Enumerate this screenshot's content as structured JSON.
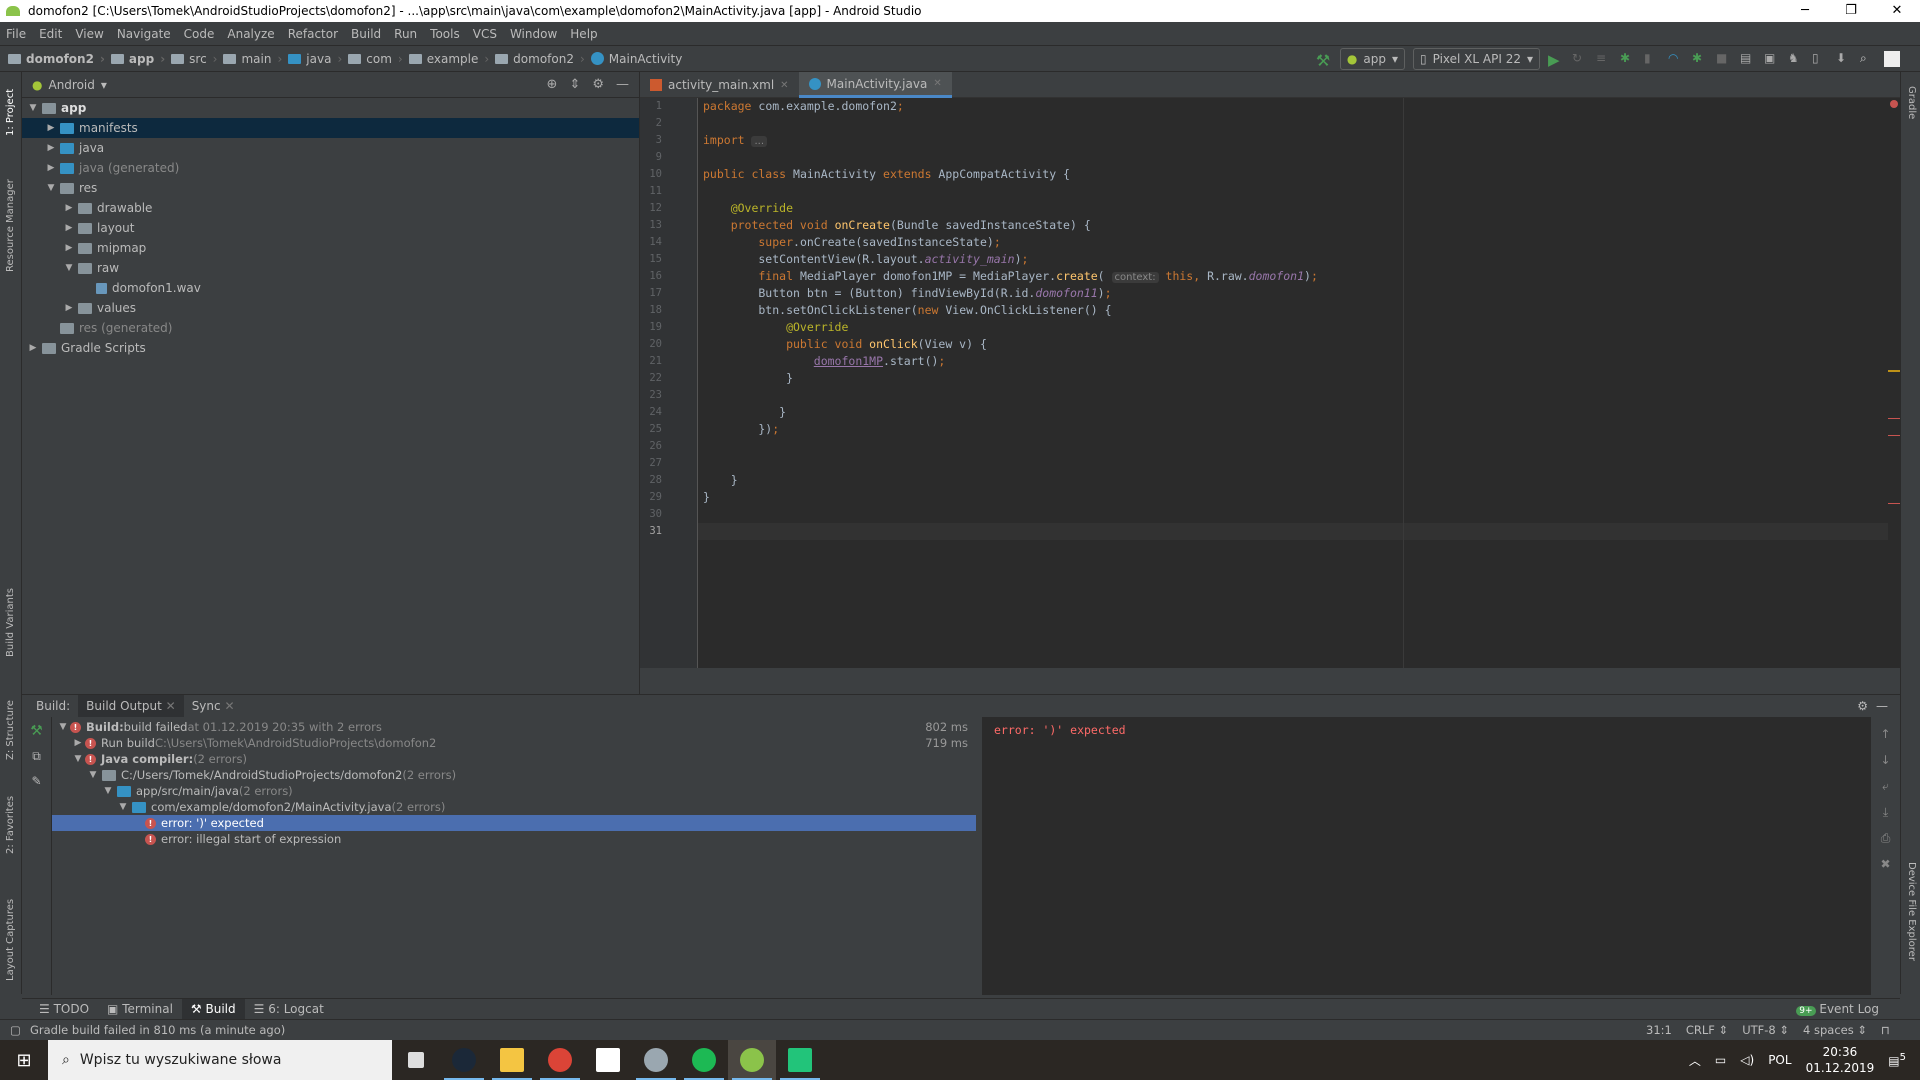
{
  "window": {
    "title": "domofon2 [C:\\Users\\Tomek\\AndroidStudioProjects\\domofon2] - ...\\app\\src\\main\\java\\com\\example\\domofon2\\MainActivity.java [app] - Android Studio",
    "minimize": "─",
    "maximize": "❐",
    "close": "✕"
  },
  "menu": [
    "File",
    "Edit",
    "View",
    "Navigate",
    "Code",
    "Analyze",
    "Refactor",
    "Build",
    "Run",
    "Tools",
    "VCS",
    "Window",
    "Help"
  ],
  "breadcrumbs": [
    "domofon2",
    "app",
    "src",
    "main",
    "java",
    "com",
    "example",
    "domofon2",
    "MainActivity"
  ],
  "toolbar": {
    "config": "app",
    "device": "Pixel XL API 22"
  },
  "left_strip": [
    "1: Project",
    "Resource Manager",
    "Build Variants",
    "Z: Structure",
    "2: Favorites",
    "Layout Captures"
  ],
  "right_strip": [
    "Gradle",
    "Device File Explorer"
  ],
  "project": {
    "view": "Android",
    "tree": [
      {
        "label": "app",
        "depth": 0,
        "arrow": "▼",
        "bold": true
      },
      {
        "label": "manifests",
        "depth": 1,
        "arrow": "▶",
        "selected": true
      },
      {
        "label": "java",
        "depth": 1,
        "arrow": "▶"
      },
      {
        "label": "java (generated)",
        "depth": 1,
        "arrow": "▶"
      },
      {
        "label": "res",
        "depth": 1,
        "arrow": "▼"
      },
      {
        "label": "drawable",
        "depth": 2,
        "arrow": "▶"
      },
      {
        "label": "layout",
        "depth": 2,
        "arrow": "▶"
      },
      {
        "label": "mipmap",
        "depth": 2,
        "arrow": "▶"
      },
      {
        "label": "raw",
        "depth": 2,
        "arrow": "▼"
      },
      {
        "label": "domofon1.wav",
        "depth": 3,
        "arrow": ""
      },
      {
        "label": "values",
        "depth": 2,
        "arrow": "▶"
      },
      {
        "label": "res (generated)",
        "depth": 1,
        "arrow": ""
      },
      {
        "label": "Gradle Scripts",
        "depth": 0,
        "arrow": "▶"
      }
    ]
  },
  "editor": {
    "tabs": [
      {
        "label": "activity_main.xml",
        "active": false
      },
      {
        "label": "MainActivity.java",
        "active": true
      }
    ],
    "lines": [
      {
        "n": "1",
        "tokens": [
          [
            "package ",
            "k"
          ],
          [
            "com.example.domofon2",
            "t"
          ],
          [
            ";",
            "k"
          ]
        ]
      },
      {
        "n": "2",
        "tokens": []
      },
      {
        "n": "3",
        "tokens": [
          [
            "import ",
            "k"
          ],
          [
            "...",
            "h"
          ]
        ]
      },
      {
        "n": "9",
        "tokens": []
      },
      {
        "n": "10",
        "tokens": [
          [
            "public class ",
            "k"
          ],
          [
            "MainActivity ",
            "t"
          ],
          [
            "extends ",
            "k"
          ],
          [
            "AppCompatActivity {",
            "t"
          ]
        ]
      },
      {
        "n": "11",
        "tokens": []
      },
      {
        "n": "12",
        "tokens": [
          [
            "    @Override",
            "a"
          ]
        ]
      },
      {
        "n": "13",
        "tokens": [
          [
            "    protected void ",
            "k"
          ],
          [
            "onCreate",
            "m"
          ],
          [
            "(Bundle savedInstanceState) {",
            "t"
          ]
        ]
      },
      {
        "n": "14",
        "tokens": [
          [
            "        super",
            "k"
          ],
          [
            ".onCreate(savedInstanceState)",
            "t"
          ],
          [
            ";",
            "k"
          ]
        ]
      },
      {
        "n": "15",
        "tokens": [
          [
            "        setContentView(R.layout.",
            "t"
          ],
          [
            "activity_main",
            "f"
          ],
          [
            ")",
            "t"
          ],
          [
            ";",
            "k"
          ]
        ]
      },
      {
        "n": "16",
        "tokens": [
          [
            "        final ",
            "k"
          ],
          [
            "MediaPlayer domofon1MP = MediaPlayer.",
            "t"
          ],
          [
            "create",
            "m"
          ],
          [
            "( ",
            "t"
          ],
          [
            "context:",
            "h"
          ],
          [
            " this, ",
            "k"
          ],
          [
            "R.raw.",
            "t"
          ],
          [
            "domofon1",
            "f"
          ],
          [
            ")",
            "t"
          ],
          [
            ";",
            "k"
          ]
        ]
      },
      {
        "n": "17",
        "tokens": [
          [
            "        Button btn = (Button) findViewById(R.id.",
            "t"
          ],
          [
            "domofon11",
            "f"
          ],
          [
            ")",
            "t"
          ],
          [
            ";",
            "k"
          ]
        ]
      },
      {
        "n": "18",
        "tokens": [
          [
            "        btn.setOnClickListener(",
            "t"
          ],
          [
            "new ",
            "k"
          ],
          [
            "View.OnClickListener() {",
            "t"
          ]
        ]
      },
      {
        "n": "19",
        "tokens": [
          [
            "            @Override",
            "a"
          ]
        ]
      },
      {
        "n": "20",
        "tokens": [
          [
            "            public void ",
            "k"
          ],
          [
            "onClick",
            "m"
          ],
          [
            "(View v) {",
            "t"
          ]
        ]
      },
      {
        "n": "21",
        "tokens": [
          [
            "                ",
            "t"
          ],
          [
            "domofon1MP",
            "pv"
          ],
          [
            ".start()",
            "t"
          ],
          [
            ";",
            "k"
          ]
        ]
      },
      {
        "n": "22",
        "tokens": [
          [
            "            }",
            "t"
          ]
        ]
      },
      {
        "n": "23",
        "tokens": []
      },
      {
        "n": "24",
        "tokens": [
          [
            "           }",
            "t"
          ]
        ]
      },
      {
        "n": "25",
        "tokens": [
          [
            "        })",
            "t"
          ],
          [
            ";",
            "k"
          ]
        ]
      },
      {
        "n": "26",
        "tokens": []
      },
      {
        "n": "27",
        "tokens": []
      },
      {
        "n": "28",
        "tokens": [
          [
            "    }",
            "t"
          ]
        ]
      },
      {
        "n": "29",
        "tokens": [
          [
            "}",
            "t"
          ]
        ]
      },
      {
        "n": "30",
        "tokens": []
      },
      {
        "n": "31",
        "tokens": [],
        "current": true
      }
    ]
  },
  "build": {
    "label": "Build:",
    "tabs": [
      "Build Output",
      "Sync"
    ],
    "tree": [
      {
        "depth": 0,
        "arrow": "▼",
        "error": true,
        "bold": "Build:",
        "text": " build failed",
        "muted": " at 01.12.2019 20:35  with 2 errors",
        "time": "802 ms"
      },
      {
        "depth": 1,
        "arrow": "▶",
        "error": true,
        "text": "Run build",
        "muted": " C:\\Users\\Tomek\\AndroidStudioProjects\\domofon2",
        "time": "719 ms"
      },
      {
        "depth": 1,
        "arrow": "▼",
        "error": true,
        "bold": "Java compiler:",
        "muted": " (2 errors)"
      },
      {
        "depth": 2,
        "arrow": "▼",
        "folder": true,
        "text": "C:/Users/Tomek/AndroidStudioProjects/domofon2",
        "muted": " (2 errors)"
      },
      {
        "depth": 3,
        "arrow": "▼",
        "folder": true,
        "text": "app/src/main/java",
        "muted": " (2 errors)"
      },
      {
        "depth": 4,
        "arrow": "▼",
        "folder": true,
        "text": "com/example/domofon2/MainActivity.java",
        "muted": " (2 errors)"
      },
      {
        "depth": 5,
        "arrow": "",
        "error": true,
        "text": "error: ')' expected",
        "selected": true
      },
      {
        "depth": 5,
        "arrow": "",
        "error": true,
        "text": "error: illegal start of expression"
      }
    ],
    "console": "error: ')' expected"
  },
  "tool_tabs": [
    "TODO",
    "Terminal",
    "Build",
    "6: Logcat"
  ],
  "event_log": {
    "label": "Event Log",
    "badge": "9+"
  },
  "status": {
    "message": "Gradle build failed in 810 ms (a minute ago)",
    "position": "31:1",
    "line_sep": "CRLF ⇕",
    "encoding": "UTF-8 ⇕",
    "indent": "4 spaces ⇕"
  },
  "taskbar": {
    "search_placeholder": "Wpisz tu wyszukiwane słowa",
    "apps": [
      {
        "name": "task-view",
        "color": "#dddddd"
      },
      {
        "name": "steam",
        "color": "#1b2838"
      },
      {
        "name": "file-explorer",
        "color": "#f4c542"
      },
      {
        "name": "chrome",
        "color": "#db4437"
      },
      {
        "name": "mail",
        "color": "#ffffff"
      },
      {
        "name": "task-manager",
        "color": "#9aa7b0"
      },
      {
        "name": "spotify",
        "color": "#1db954"
      },
      {
        "name": "android-studio",
        "color": "#8bc34a"
      },
      {
        "name": "app-green",
        "color": "#22c47a"
      }
    ],
    "lang": "POL",
    "time": "20:36",
    "date": "01.12.2019",
    "notifications": "5"
  },
  "colors": {
    "accent": "#4a88c7",
    "error": "#c75450",
    "selection": "#4b6eaf"
  }
}
